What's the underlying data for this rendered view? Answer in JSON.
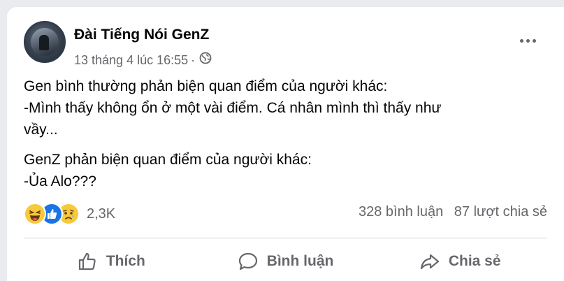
{
  "post": {
    "page_name": "Đài Tiếng Nói GenZ",
    "timestamp": "13 tháng 4 lúc 16:55",
    "separator": "·",
    "privacy_icon": "globe-icon",
    "more_icon": "more-horizontal-icon",
    "content": {
      "paragraph_1": [
        "Gen bình thường phản biện quan điểm của người khác:",
        "-Mình thấy không ổn ở một vài điểm. Cá nhân mình thì thấy như",
        "vầy..."
      ],
      "paragraph_2": [
        "GenZ phản biện quan điểm của người khác:",
        "-Ủa Alo???"
      ]
    },
    "reactions": {
      "icons": [
        "haha-reaction-icon",
        "like-reaction-icon",
        "sad-reaction-icon"
      ],
      "count": "2,3K"
    },
    "comments_count": "328 bình luận",
    "shares_count": "87 lượt chia sẻ",
    "actions": {
      "like_label": "Thích",
      "comment_label": "Bình luận",
      "share_label": "Chia sẻ"
    }
  },
  "colors": {
    "background": "#e9ebee",
    "card": "#ffffff",
    "primary_text": "#050505",
    "secondary_text": "#65676b",
    "like_blue": "#1b74e4",
    "reaction_yellow": "#f7c93c",
    "divider": "#ced0d4"
  }
}
